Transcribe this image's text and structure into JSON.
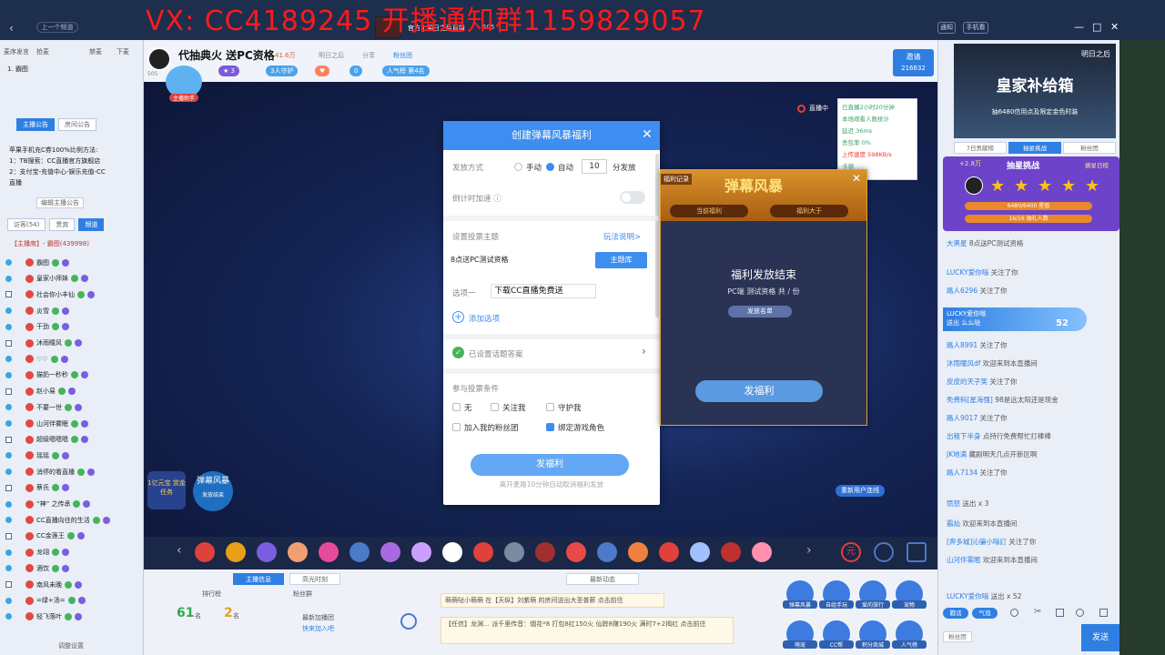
{
  "watermark": "VX: CC4189245 开播通知群1159829057",
  "top": {
    "prev_label": "上一个频道",
    "stream_title": "官方 | 明日之后直播",
    "viewers": "505",
    "notify": "通知",
    "phone_live": "手机看",
    "win_min": "—",
    "win_max": "□",
    "win_close": "✕"
  },
  "left": {
    "tabs_top": [
      "麦序发言",
      "抢麦",
      "禁麦",
      "下麦"
    ],
    "first_user": "1. 霸图",
    "ann_tabs": [
      "主播公告",
      "房间公告"
    ],
    "announcement_lines": [
      "苹果手机充C券100%比例方法:",
      "1：TB搜索：CC直播官方旗舰店",
      "2：支付宝-充值中心-娱乐充值-CC",
      "直播"
    ],
    "edit_ann": "编辑主播公告",
    "list_tabs": [
      "访客(54)",
      "贵宾",
      "频道"
    ],
    "list_head": "【主播席】- 霸图(439998)",
    "users": [
      "霸图",
      "皇家小师妹",
      "社会你小丰仙",
      "炎雪",
      "干劲",
      "沐雨瞳风",
      "♡♡",
      "猫奶一秒秒",
      "赵小易",
      "不要一世",
      "山河伴雾眠",
      "超级嗯嗯嗯",
      "瑶瑶",
      "消停的看直播",
      "蔡氏",
      "“神” 之传承",
      "CC直播向往的生活",
      "CC金莲王",
      "龙翊",
      "酒饮",
      "南风未晚",
      "=绿+汤=",
      "轻飞落叶"
    ],
    "bottom_hint": "调整设置"
  },
  "stream": {
    "anchor_name": "代抽典火 送PC资格",
    "anchor_id": "505",
    "heat": "41.6万",
    "tag1": "明日之后",
    "share": "分享",
    "fan_group": "粉丝团",
    "guard_btn": "3人守护",
    "people_btn": "0",
    "popular_btn": "人气榜 第4名",
    "invite_label": "邀请",
    "invite_count": "216632",
    "assistant_label": "主播助手",
    "live_label": "直播中"
  },
  "stats": {
    "lines": [
      "已直播2小时20分钟",
      "本场观看人数统计",
      "延迟    36ms",
      "丢包率   0%",
      "上传速度  598KB/s",
      "卡顿"
    ]
  },
  "dialog": {
    "title": "创建弹幕风暴福利",
    "close": "✕",
    "mode_label": "发放方式",
    "manual": "手动",
    "auto": "自动",
    "auto_count": "10",
    "auto_unit": "分发放",
    "countdown": "倒计时加速 ⓘ",
    "topic_label": "设置投票主题",
    "rules_link": "玩法说明>",
    "topic_value": "8点送PC测试资格",
    "topic_btn": "主题库",
    "option_label": "选项一",
    "option_value": "下载CC直播免费送",
    "add_option": "添加选项",
    "answer_set": "已设置话题答案",
    "answer_arrow": "›",
    "cond_label": "参与投票条件",
    "cond_none": "无",
    "cond_follow": "关注我",
    "cond_guard": "守护我",
    "cond_fans": "加入我的粉丝团",
    "cond_role": "绑定游戏角色",
    "send": "发福利",
    "hint": "离开麦路10分钟自动取消福利发放"
  },
  "popup": {
    "record": "福利记录",
    "title": "弹幕风暴",
    "close": "✕",
    "tab_current": "当前福利",
    "tab_next": "福利大于",
    "end_title": "福利发放结束",
    "prize": "PC端 测试资格   共 / 份",
    "list_btn": "发放名单",
    "fuli_btn": "发福利"
  },
  "video_badges": {
    "task_badge": "1亿元宝 赏金任务",
    "storm_badge": "弹幕风暴",
    "storm_sub": "发放结束",
    "return_line": "重新用户连线"
  },
  "bottom": {
    "tab_info": "主播信息",
    "tab_hot": "高光时刻",
    "tab_news": "最新动态",
    "rank_label": "排行榜",
    "fans_label": "粉丝群",
    "rank_num": "61",
    "rank_unit": "名",
    "fan_num": "2",
    "fan_unit": "名",
    "recent_label": "最新加播团",
    "recent_link": "快来加入吧",
    "feed1": "萌萌哒小萌萌  在【天纵】刘紫萌 的房间送出大圣普薪 点击前往",
    "feed2_line1": "【任信】龙渊…  派千里传音：烟花*8 打包8红150火 仙踪8赚190火 满时7+2揭红 点击前往",
    "feed2_line2": "",
    "icons": [
      "弹幕风暴",
      "自组手玩",
      "爱的旅行",
      "宠物",
      "萌宠",
      "CC帮",
      "积分商城",
      "人气榜"
    ]
  },
  "right": {
    "ad_brand": "明日之后",
    "ad_title": "皇家补给箱",
    "ad_sub": "抽6480信用点及限定金色时装",
    "tabs": [
      "7日贡献榜",
      "抽星挑战",
      "粉丝团"
    ],
    "ch_score": "+2.8万",
    "ch_title": "抽星挑战",
    "ch_open": "摘星日榜",
    "bar1": "6480/6400 星值",
    "bar2": "16/16 抽礼人数",
    "chats": [
      {
        "u": "大黑星",
        "t": "8点送PC测试资格"
      },
      {
        "u": "LUCKY爱你嗡",
        "t": "关注了你"
      },
      {
        "u": "路人6296",
        "t": "关注了你"
      },
      {
        "u": "路人8991",
        "t": "关注了你"
      },
      {
        "u": "沐雨瞳风df",
        "t": "欢迎来到本直播间"
      },
      {
        "u": "皮皮的天子笑",
        "t": "关注了你"
      },
      {
        "u": "免费码[星海强]",
        "t": "98是远太阳还是现金"
      },
      {
        "u": "路人9017",
        "t": "关注了你"
      },
      {
        "u": "出租下半身",
        "t": "点持行免费帮忙打棒棒"
      },
      {
        "u": "JK地满",
        "t": "藏剧明天几点开新区啊"
      },
      {
        "u": "路人7134",
        "t": "关注了你"
      },
      {
        "u": "愤怒",
        "t": "送出  x 3"
      },
      {
        "u": "霸灿",
        "t": "欢迎来到本直播间"
      },
      {
        "u": "[奔多城]沁骗小嗡訂",
        "t": "关注了你"
      },
      {
        "u": "山河伴雾眠",
        "t": "欢迎来到本直播间"
      },
      {
        "u": "LUCKY爱你嗡",
        "t": "送出  x 52"
      }
    ],
    "lucky_name": "LUCKY爱你嗡",
    "lucky_text": "送出 么么哒",
    "lucky_count": "52",
    "pill1": "戳话",
    "pill2": "气泡",
    "fan_badge": "粉丝团",
    "send": "发送"
  },
  "colors": {
    "accent": "#3d8ef0",
    "danger": "#e0413a",
    "watermark": "#ff1a1a"
  }
}
